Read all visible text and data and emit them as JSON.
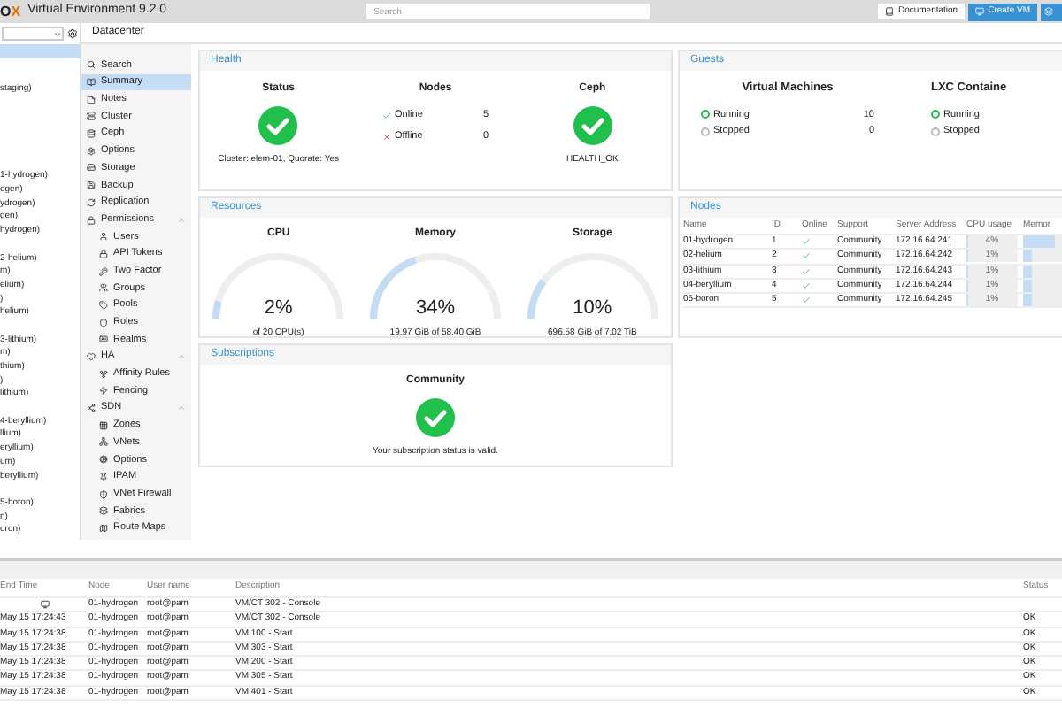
{
  "header": {
    "logo": "O",
    "logo_accent": "X",
    "title": "Virtual Environment 9.2.0",
    "search": {
      "placeholder": "Search"
    },
    "buttons": [
      {
        "kind": "plain",
        "label": "Documentation"
      },
      {
        "kind": "primary",
        "label": "Create VM"
      },
      {
        "kind": "primary-cut"
      }
    ]
  },
  "tree": {
    "root_selected": true,
    "groups": [
      {
        "items": [
          "staging)"
        ]
      },
      {
        "items": [
          "1-hydrogen)",
          "ogen)",
          "ydrogen)",
          "gen)",
          "hydrogen)"
        ]
      },
      {
        "items": [
          "2-helium)",
          "m)",
          "elium)",
          ")",
          "helium)"
        ]
      },
      {
        "items": [
          "3-lithium)",
          "m)",
          "thium)",
          ")",
          "lithium)"
        ]
      },
      {
        "items": [
          "4-beryllium)",
          "llium)",
          "eryllium)",
          "um)",
          "beryllium)"
        ]
      },
      {
        "items": [
          "5-boron)",
          "n)",
          "oron)"
        ]
      }
    ]
  },
  "breadcrumb": "Datacenter",
  "menu": [
    {
      "label": "Search",
      "selected": false
    },
    {
      "label": "Summary",
      "selected": true
    },
    {
      "label": "Notes",
      "selected": false
    },
    {
      "label": "Cluster",
      "selected": false
    },
    {
      "label": "Ceph",
      "selected": false
    },
    {
      "label": "Options",
      "selected": false
    },
    {
      "label": "Storage",
      "selected": false
    },
    {
      "label": "Backup",
      "selected": false
    },
    {
      "label": "Replication",
      "selected": false
    },
    {
      "label": "Permissions",
      "selected": false,
      "expanded": true,
      "children": [
        {
          "label": "Users",
          "selected": false
        },
        {
          "label": "API Tokens",
          "selected": false
        },
        {
          "label": "Two Factor",
          "selected": false
        },
        {
          "label": "Groups",
          "selected": false
        },
        {
          "label": "Pools",
          "selected": false
        },
        {
          "label": "Roles",
          "selected": false
        },
        {
          "label": "Realms",
          "selected": false
        }
      ]
    },
    {
      "label": "HA",
      "selected": false,
      "expanded": true,
      "children": [
        {
          "label": "Affinity Rules",
          "selected": false
        },
        {
          "label": "Fencing",
          "selected": false
        }
      ]
    },
    {
      "label": "SDN",
      "selected": false,
      "expanded": true,
      "children": [
        {
          "label": "Zones",
          "selected": false
        },
        {
          "label": "VNets",
          "selected": false
        },
        {
          "label": "Options",
          "selected": false
        },
        {
          "label": "IPAM",
          "selected": false
        },
        {
          "label": "VNet Firewall",
          "selected": false
        },
        {
          "label": "Fabrics",
          "selected": false
        },
        {
          "label": "Route Maps",
          "selected": false
        }
      ]
    }
  ],
  "health": {
    "title": "Health",
    "status": {
      "title": "Status",
      "ok": true,
      "text": "Cluster: elem-01, Quorate: Yes"
    },
    "nodes": {
      "title": "Nodes",
      "rows": [
        {
          "kind": "online",
          "label": "Online",
          "count": "5"
        },
        {
          "kind": "offline",
          "label": "Offline",
          "count": "0"
        }
      ]
    },
    "ceph": {
      "title": "Ceph",
      "ok": true,
      "text": "HEALTH_OK"
    }
  },
  "guests": {
    "title": "Guests",
    "groups": [
      {
        "title": "Virtual Machines",
        "rows": [
          {
            "kind": "running",
            "label": "Running",
            "count": "10"
          },
          {
            "kind": "stopped",
            "label": "Stopped",
            "count": "0"
          }
        ]
      },
      {
        "title": "LXC Containe",
        "rows": [
          {
            "kind": "running",
            "label": "Running"
          },
          {
            "kind": "stopped",
            "label": "Stopped"
          }
        ]
      }
    ]
  },
  "resources": {
    "title": "Resources",
    "gauges": [
      {
        "title": "CPU",
        "value": "2%",
        "level": 0.02,
        "detail": "of 20 CPU(s)"
      },
      {
        "title": "Memory",
        "value": "34%",
        "level": 0.34,
        "detail": "19.97 GiB of 58.40 GiB"
      },
      {
        "title": "Storage",
        "value": "10%",
        "level": 0.1,
        "detail": "696.58 GiB of 7.02 TiB"
      }
    ]
  },
  "nodes": {
    "title": "Nodes",
    "columns": [
      "Name",
      "ID",
      "Online",
      "Support",
      "Server Address",
      "CPU usage",
      "Memor"
    ],
    "rows": [
      {
        "name": "01-hydrogen",
        "id": "1",
        "online": true,
        "support": "Community",
        "address": "172.16.64.241",
        "cpu": {
          "text": "4%",
          "level": 0.04
        },
        "memory": {
          "level": 0.6
        }
      },
      {
        "name": "02-helium",
        "id": "2",
        "online": true,
        "support": "Community",
        "address": "172.16.64.242",
        "cpu": {
          "text": "1%",
          "level": 0.01
        },
        "memory": {
          "level": 0.15
        }
      },
      {
        "name": "03-lithium",
        "id": "3",
        "online": true,
        "support": "Community",
        "address": "172.16.64.243",
        "cpu": {
          "text": "1%",
          "level": 0.01
        },
        "memory": {
          "level": 0.15
        }
      },
      {
        "name": "04-beryllium",
        "id": "4",
        "online": true,
        "support": "Community",
        "address": "172.16.64.244",
        "cpu": {
          "text": "1%",
          "level": 0.01
        },
        "memory": {
          "level": 0.15
        }
      },
      {
        "name": "05-boron",
        "id": "5",
        "online": true,
        "support": "Community",
        "address": "172.16.64.245",
        "cpu": {
          "text": "1%",
          "level": 0.01
        },
        "memory": {
          "level": 0.15
        }
      }
    ]
  },
  "subscriptions": {
    "title": "Subscriptions",
    "heading": "Community",
    "ok": true,
    "text": "Your subscription status is valid."
  },
  "tasks": {
    "columns": [
      "End Time",
      "Node",
      "User name",
      "Description",
      "Status"
    ],
    "rows": [
      {
        "kind": "running",
        "node": "01-hydrogen",
        "user": "root@pam",
        "description": "VM/CT 302 - Console"
      },
      {
        "kind": "done",
        "end_time": "May 15 17:24:43",
        "node": "01-hydrogen",
        "user": "root@pam",
        "description": "VM/CT 302 - Console",
        "status": "OK"
      },
      {
        "kind": "done",
        "end_time": "May 15 17:24:38",
        "node": "01-hydrogen",
        "user": "root@pam",
        "description": "VM 100 - Start",
        "status": "OK"
      },
      {
        "kind": "done",
        "end_time": "May 15 17:24:38",
        "node": "01-hydrogen",
        "user": "root@pam",
        "description": "VM 303 - Start",
        "status": "OK"
      },
      {
        "kind": "done",
        "end_time": "May 15 17:24:38",
        "node": "01-hydrogen",
        "user": "root@pam",
        "description": "VM 200 - Start",
        "status": "OK"
      },
      {
        "kind": "done",
        "end_time": "May 15 17:24:38",
        "node": "01-hydrogen",
        "user": "root@pam",
        "description": "VM 305 - Start",
        "status": "OK"
      },
      {
        "kind": "done",
        "end_time": "May 15 17:24:38",
        "node": "01-hydrogen",
        "user": "root@pam",
        "description": "VM 401 - Start",
        "status": "OK"
      }
    ]
  }
}
